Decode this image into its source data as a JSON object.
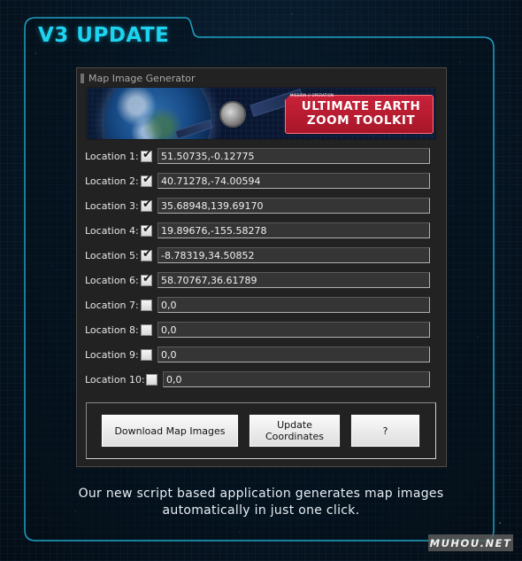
{
  "headline": "V3 UPDATE",
  "panel": {
    "title": "Map Image Generator",
    "banner": {
      "tag": "MISSION // OPERATION",
      "line1": "ULTIMATE EARTH",
      "line2": "ZOOM TOOLKIT"
    },
    "locations": [
      {
        "label": "Location 1:",
        "checked": true,
        "value": "51.50735,-0.12775"
      },
      {
        "label": "Location 2:",
        "checked": true,
        "value": "40.71278,-74.00594"
      },
      {
        "label": "Location 3:",
        "checked": true,
        "value": "35.68948,139.69170"
      },
      {
        "label": "Location 4:",
        "checked": true,
        "value": "19.89676,-155.58278"
      },
      {
        "label": "Location 5:",
        "checked": true,
        "value": "-8.78319,34.50852"
      },
      {
        "label": "Location 6:",
        "checked": true,
        "value": "58.70767,36.61789"
      },
      {
        "label": "Location 7:",
        "checked": false,
        "value": "0,0"
      },
      {
        "label": "Location 8:",
        "checked": false,
        "value": "0,0"
      },
      {
        "label": "Location 9:",
        "checked": false,
        "value": "0,0"
      },
      {
        "label": "Location 10:",
        "checked": false,
        "value": "0,0"
      }
    ],
    "buttons": {
      "download": "Download Map Images",
      "update": "Update Coordinates",
      "help": "?"
    },
    "check_glyph": "✔"
  },
  "caption": {
    "line1": "Our new script based application generates map images",
    "line2": "automatically in just one click."
  },
  "watermark": "MUHOU.NET",
  "colors": {
    "accent": "#1ed3f0",
    "frame": "#1fa3c4",
    "badge": "#c8223a",
    "panel": "#222222"
  }
}
